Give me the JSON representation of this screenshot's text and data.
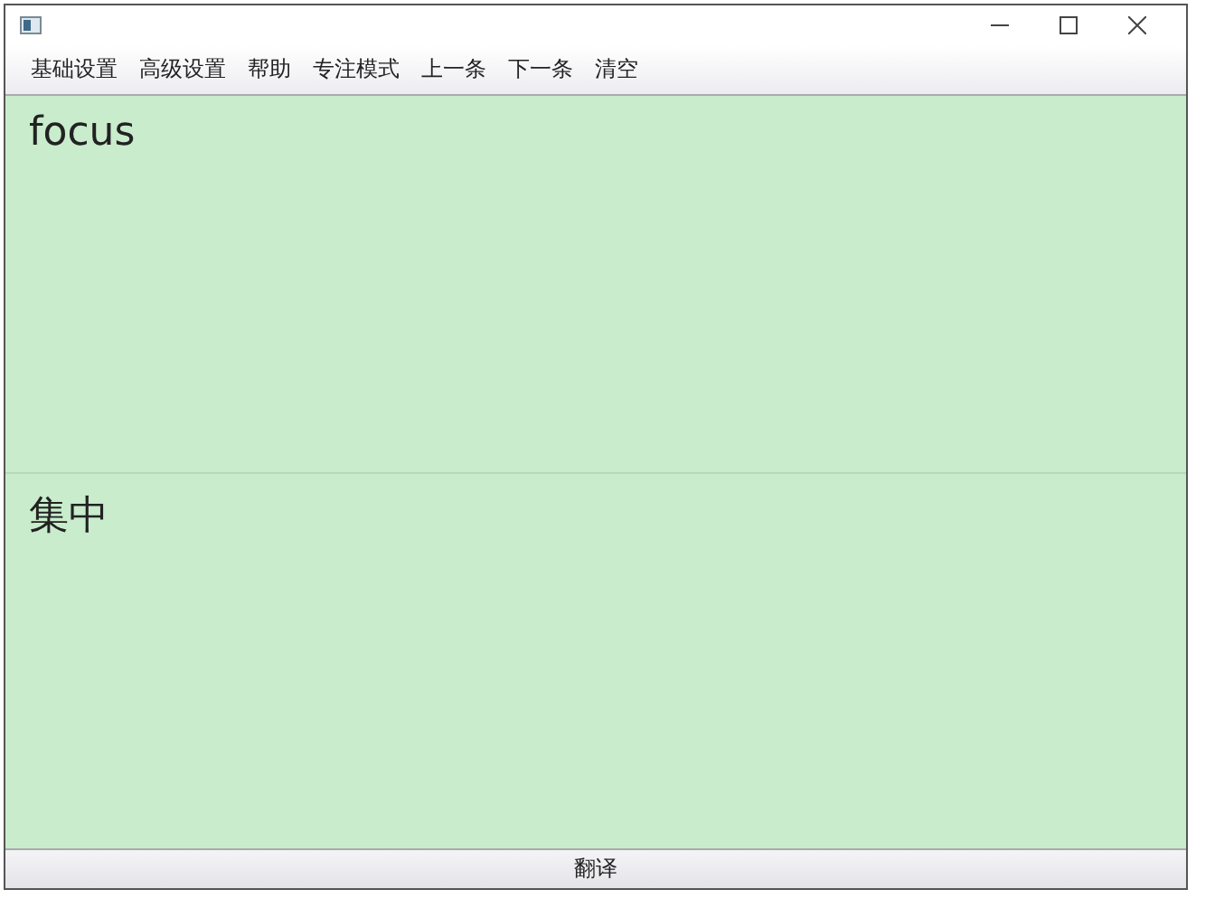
{
  "menu": [
    "基础设置",
    "高级设置",
    "帮助",
    "专注模式",
    "上一条",
    "下一条",
    "清空"
  ],
  "source_text": {
    "value": "focus"
  },
  "translation_text": {
    "value": "集中"
  },
  "translate_button": "翻译"
}
